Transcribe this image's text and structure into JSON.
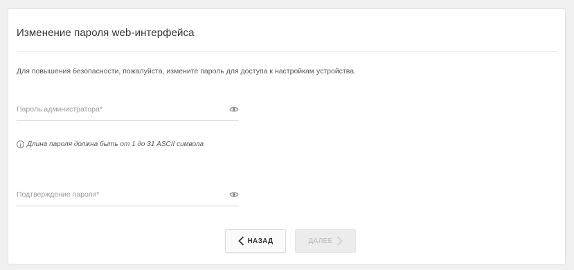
{
  "form": {
    "title": "Изменение пароля web-интерфейса",
    "description": "Для повышения безопасности, пожалуйста, измените пароль для доступа к настройкам устройства.",
    "admin_password": {
      "placeholder": "Пароль администратора*",
      "value": "",
      "icon": "eye-icon"
    },
    "hint": {
      "icon": "info-icon",
      "text": "Длина пароля должна быть от 1 до 31 ASCII символа"
    },
    "confirm_password": {
      "placeholder": "Подтверждение пароля*",
      "value": "",
      "icon": "eye-icon"
    }
  },
  "buttons": {
    "back_label": "НАЗАД",
    "next_label": "ДАЛЕЕ",
    "next_enabled": false
  },
  "colors": {
    "background": "#f0f0f0",
    "card": "#ffffff",
    "text": "#333333",
    "muted": "#9a9a9a",
    "disabled_button": "#ececec"
  }
}
